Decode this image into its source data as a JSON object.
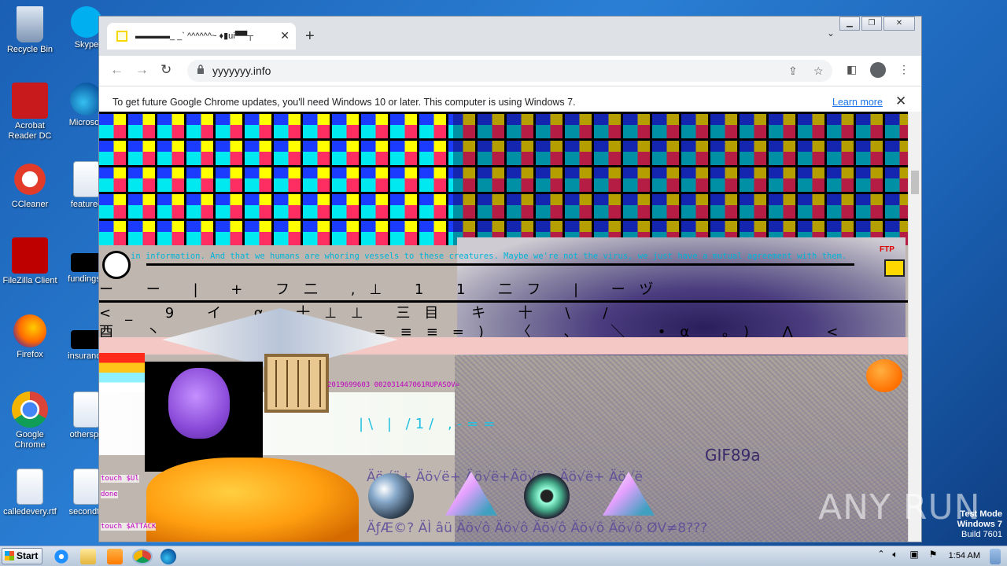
{
  "desktop": {
    "icons": [
      {
        "label": "Recycle Bin"
      },
      {
        "label": "Skype"
      },
      {
        "label": "Acrobat Reader DC"
      },
      {
        "label": "Microsoft"
      },
      {
        "label": "CCleaner"
      },
      {
        "label": "featured"
      },
      {
        "label": "FileZilla Client"
      },
      {
        "label": "fundingse"
      },
      {
        "label": "Firefox"
      },
      {
        "label": "insurance"
      },
      {
        "label": "Google Chrome"
      },
      {
        "label": "otherspo"
      },
      {
        "label": "calledevery.rtf"
      },
      {
        "label": "secondto"
      }
    ]
  },
  "browser": {
    "tab_title": "▬▬▬▬_ _` ^^^^^^~ ♦▮ui▀▀┬",
    "url": "yyyyyyy.info",
    "infobar_message": "To get future Google Chrome updates, you'll need Windows 10 or later. This computer is using Windows 7.",
    "infobar_link": "Learn more"
  },
  "page": {
    "ticker": "in information. And that we humans are whoring vessels to these creatures. Maybe we're not the virus, we just have a mutual agreement with them.",
    "glyph_row_1": "ー ー | + フ二 ,⊥ 1 1 二フ | ーヅ",
    "glyph_row_2": "<_ 9 イ α 十⊥⊥ 三目 キ 十 \\ /",
    "glyph_row_3": "酉 丶 _ q_ ====≡≡=) 〈 、 ＼ •α 。) ⋀ <",
    "code_line": "2019699603 002031447061RUPASOV=",
    "ascii_lines": "|\\ | /1/  ,-==",
    "gif_label": "GIF89a",
    "mojibake_1": "Äö√ë+ Äö√ë+ Äö√ë+Äö√ë+ Äö√ë+ Äö√ë",
    "mojibake_2": "ÄƒÆ©? ÄÌ âü Äö√ô Äö√ô Äö√ô Äö√ô Äö√ô ØV≠8???",
    "side_labels": [
      "touch $Ul",
      "done",
      "touch $ATTACK"
    ],
    "ftp_label": "FTP"
  },
  "watermark": {
    "brand": "ANY RUN",
    "test_mode": "Test Mode",
    "os": "Windows 7",
    "build": "Build 7601"
  },
  "taskbar": {
    "start_label": "Start",
    "clock": "1:54 AM"
  }
}
